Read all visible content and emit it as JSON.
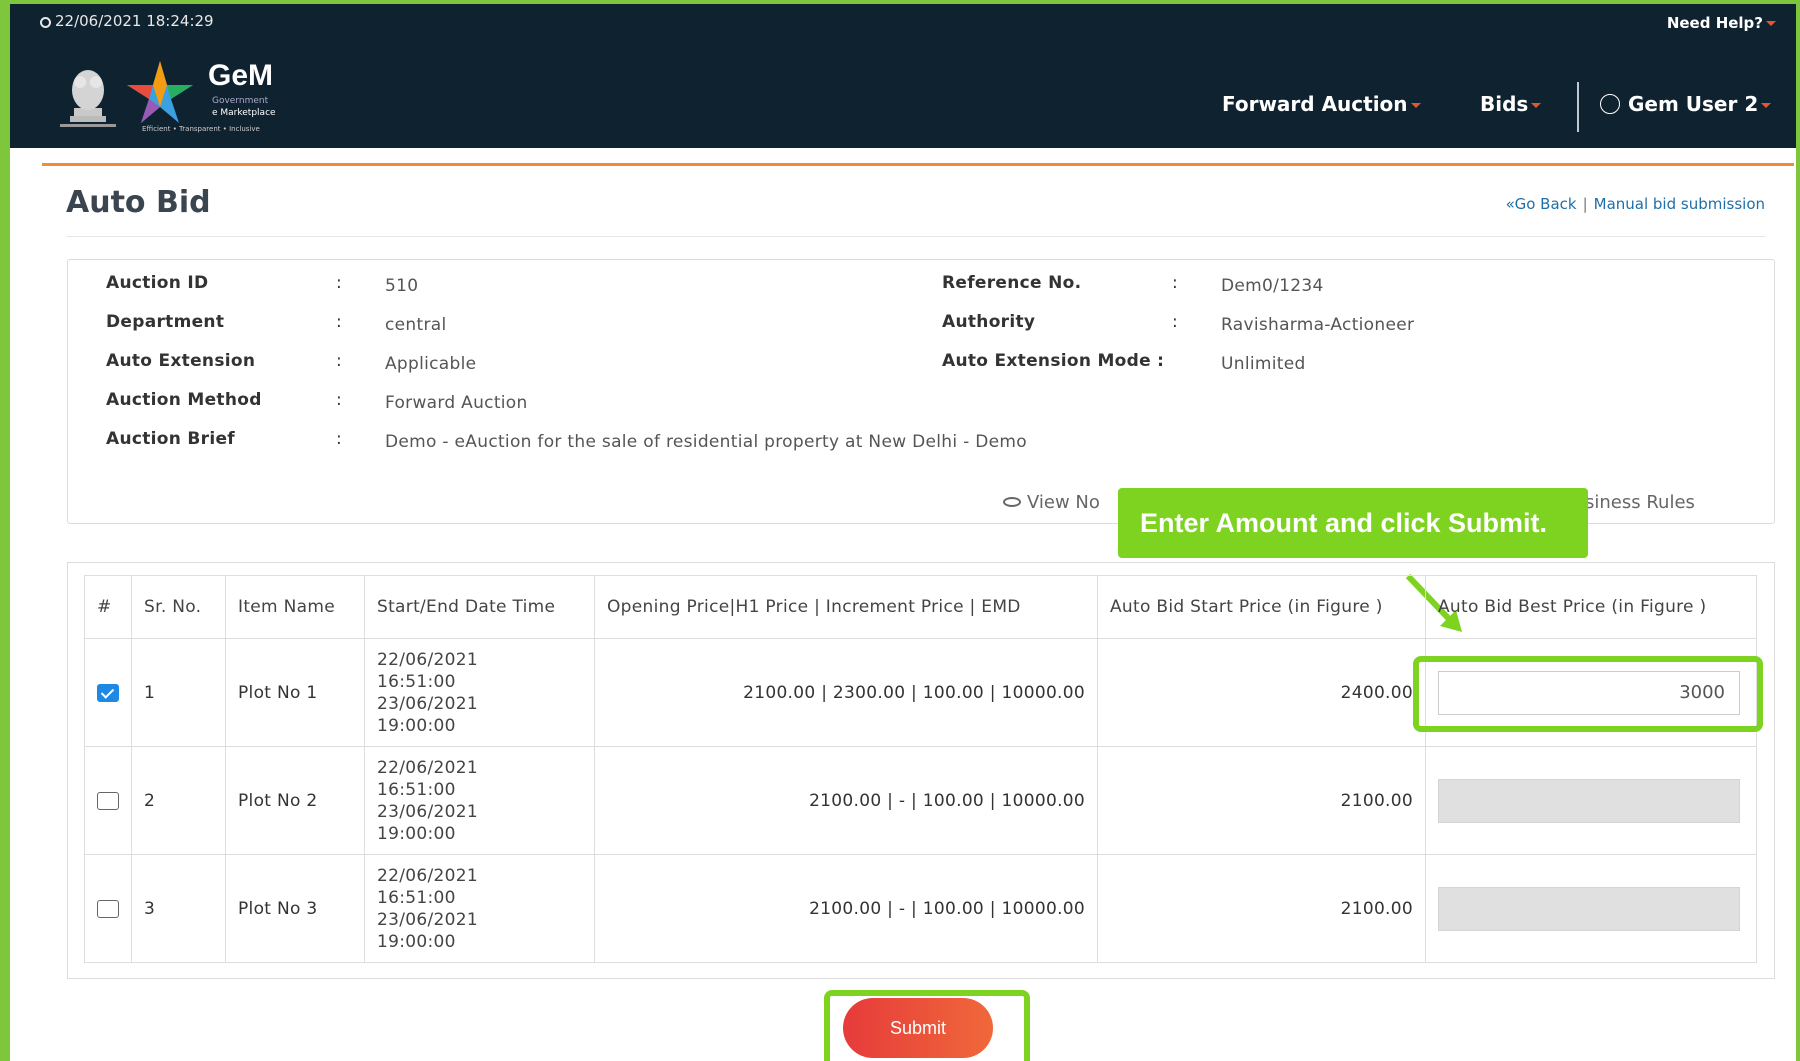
{
  "header": {
    "datetime": "22/06/2021 18:24:29",
    "need_help": "Need Help?",
    "logo": {
      "name": "GeM",
      "sub1": "Government",
      "sub2": "e Marketplace",
      "tagline": "Efficient • Transparent • Inclusive"
    },
    "nav": {
      "forward_auction": "Forward Auction",
      "bids": "Bids",
      "user": "Gem User 2"
    }
  },
  "page": {
    "title": "Auto Bid",
    "go_back": "«Go Back",
    "manual_bid": "Manual bid submission"
  },
  "info": {
    "auction_id_label": "Auction ID",
    "auction_id": "510",
    "department_label": "Department",
    "department": "central",
    "auto_extension_label": "Auto Extension",
    "auto_extension": "Applicable",
    "auction_method_label": "Auction Method",
    "auction_method": "Forward Auction",
    "auction_brief_label": "Auction Brief",
    "auction_brief": "Demo - eAuction for the sale of residential property at New Delhi - Demo",
    "reference_label": "Reference No.",
    "reference": "Dem0/1234",
    "authority_label": "Authority",
    "authority": "Ravisharma-Actioneer",
    "auto_extension_mode_label": "Auto Extension Mode :",
    "auto_extension_mode": "Unlimited",
    "colon": ":",
    "view_notice": "View No",
    "business_rules": "siness Rules"
  },
  "callout": "Enter Amount and click Submit.",
  "table": {
    "headers": {
      "hash": "#",
      "sr_no": "Sr. No.",
      "item_name": "Item Name",
      "start_end": "Start/End Date Time",
      "prices": "Opening Price|H1 Price | Increment Price | EMD",
      "auto_start": "Auto Bid Start Price (in Figure )",
      "auto_best": "Auto Bid Best Price (in Figure )"
    },
    "rows": [
      {
        "sr": "1",
        "item": "Plot No 1",
        "start_date": "22/06/2021",
        "start_time": "16:51:00",
        "end_date": "23/06/2021",
        "end_time": "19:00:00",
        "prices": "2100.00 | 2300.00 | 100.00 | 10000.00",
        "auto_start": "2400.00",
        "best": "3000"
      },
      {
        "sr": "2",
        "item": "Plot No 2",
        "start_date": "22/06/2021",
        "start_time": "16:51:00",
        "end_date": "23/06/2021",
        "end_time": "19:00:00",
        "prices": "2100.00 | - | 100.00 | 10000.00",
        "auto_start": "2100.00",
        "best": ""
      },
      {
        "sr": "3",
        "item": "Plot No 3",
        "start_date": "22/06/2021",
        "start_time": "16:51:00",
        "end_date": "23/06/2021",
        "end_time": "19:00:00",
        "prices": "2100.00 | - | 100.00 | 10000.00",
        "auto_start": "2100.00",
        "best": ""
      }
    ]
  },
  "submit_label": "Submit",
  "colors": {
    "header_bg": "#0f2230",
    "accent_orange": "#f08d33",
    "highlight_green": "#7ed321",
    "link_blue": "#1f6fa8",
    "submit_red": "#e63b3b"
  }
}
